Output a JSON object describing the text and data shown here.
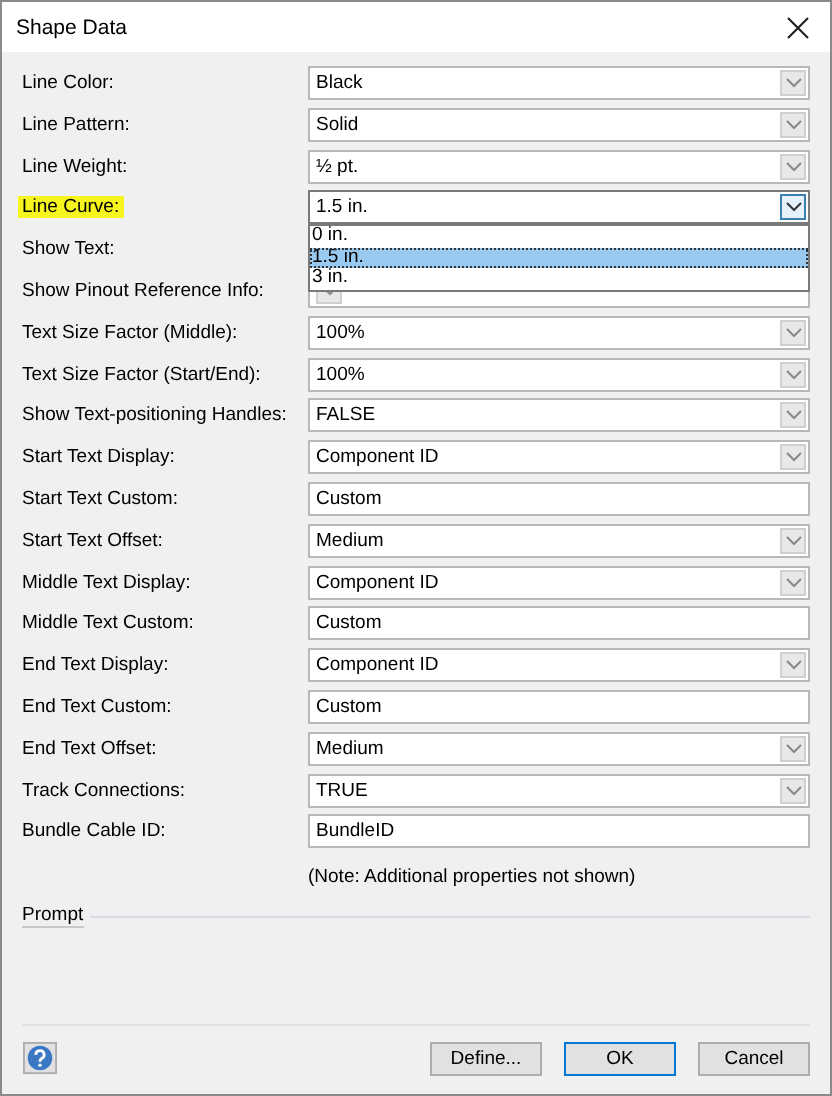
{
  "window": {
    "title": "Shape Data"
  },
  "properties": [
    {
      "label": "Line Color:",
      "kind": "dropdown",
      "value": "Black",
      "highlighted": false
    },
    {
      "label": "Line Pattern:",
      "kind": "dropdown",
      "value": "Solid",
      "highlighted": false
    },
    {
      "label": "Line Weight:",
      "kind": "dropdown",
      "value": "½ pt.",
      "highlighted": false
    },
    {
      "label": "Line Curve:",
      "kind": "dropdown",
      "value": "1.5 in.",
      "highlighted": true,
      "options": [
        {
          "label": "0 in.",
          "selected": false
        },
        {
          "label": "1.5 in.",
          "selected": true
        },
        {
          "label": "3 in.",
          "selected": false
        }
      ]
    },
    {
      "label": "Show Text:",
      "highlighted": false
    },
    {
      "label": "Show Pinout Reference Info:",
      "kind": "dropdown",
      "highlighted": false
    },
    {
      "label": "Text Size Factor (Middle):",
      "kind": "dropdown",
      "value": "100%",
      "highlighted": false
    },
    {
      "label": "Text Size Factor (Start/End):",
      "kind": "dropdown",
      "value": "100%",
      "highlighted": false
    },
    {
      "label": "Show Text-positioning Handles:",
      "kind": "dropdown",
      "value": "FALSE",
      "highlighted": false
    },
    {
      "label": "Start Text Display:",
      "kind": "dropdown",
      "value": "Component ID",
      "highlighted": false
    },
    {
      "label": "Start Text Custom:",
      "kind": "text",
      "value": "Custom",
      "highlighted": false
    },
    {
      "label": "Start Text Offset:",
      "kind": "dropdown",
      "value": "Medium",
      "highlighted": false
    },
    {
      "label": "Middle Text Display:",
      "kind": "dropdown",
      "value": "Component ID",
      "highlighted": false
    },
    {
      "label": "Middle Text Custom:",
      "kind": "text",
      "value": "Custom",
      "highlighted": false
    },
    {
      "label": "End Text Display:",
      "kind": "dropdown",
      "value": "Component ID",
      "highlighted": false
    },
    {
      "label": "End Text Custom:",
      "kind": "text",
      "value": "Custom",
      "highlighted": false
    },
    {
      "label": "End Text Offset:",
      "kind": "dropdown",
      "value": "Medium",
      "highlighted": false
    },
    {
      "label": "Track Connections:",
      "kind": "dropdown",
      "value": "TRUE",
      "highlighted": false
    },
    {
      "label": "Bundle Cable ID:",
      "kind": "text",
      "value": "BundleID",
      "highlighted": false
    }
  ],
  "note": "(Note: Additional properties not shown)",
  "prompt": {
    "label": "Prompt"
  },
  "buttons": [
    {
      "label": "Define...",
      "default": false
    },
    {
      "label": "OK",
      "default": true
    },
    {
      "label": "Cancel",
      "default": false
    }
  ]
}
